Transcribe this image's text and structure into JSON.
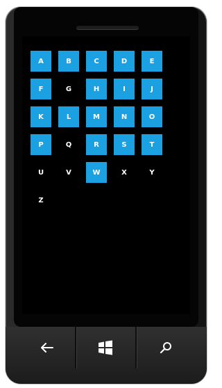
{
  "tiles": [
    {
      "letter": "A",
      "filled": true
    },
    {
      "letter": "B",
      "filled": true
    },
    {
      "letter": "C",
      "filled": true
    },
    {
      "letter": "D",
      "filled": true
    },
    {
      "letter": "E",
      "filled": true
    },
    {
      "letter": "F",
      "filled": true
    },
    {
      "letter": "G",
      "filled": false
    },
    {
      "letter": "H",
      "filled": true
    },
    {
      "letter": "I",
      "filled": true
    },
    {
      "letter": "J",
      "filled": true
    },
    {
      "letter": "K",
      "filled": true
    },
    {
      "letter": "L",
      "filled": true
    },
    {
      "letter": "M",
      "filled": true
    },
    {
      "letter": "N",
      "filled": true
    },
    {
      "letter": "O",
      "filled": true
    },
    {
      "letter": "P",
      "filled": true
    },
    {
      "letter": "Q",
      "filled": false
    },
    {
      "letter": "R",
      "filled": true
    },
    {
      "letter": "S",
      "filled": true
    },
    {
      "letter": "T",
      "filled": true
    },
    {
      "letter": "U",
      "filled": false
    },
    {
      "letter": "V",
      "filled": false
    },
    {
      "letter": "W",
      "filled": true
    },
    {
      "letter": "X",
      "filled": false
    },
    {
      "letter": "Y",
      "filled": false
    },
    {
      "letter": "Z",
      "filled": false
    }
  ],
  "colors": {
    "accent": "#1ba1e2",
    "screen_bg": "#000000"
  },
  "hardware_buttons": [
    {
      "icon": "back-arrow-icon"
    },
    {
      "icon": "windows-start-icon"
    },
    {
      "icon": "search-icon"
    }
  ]
}
